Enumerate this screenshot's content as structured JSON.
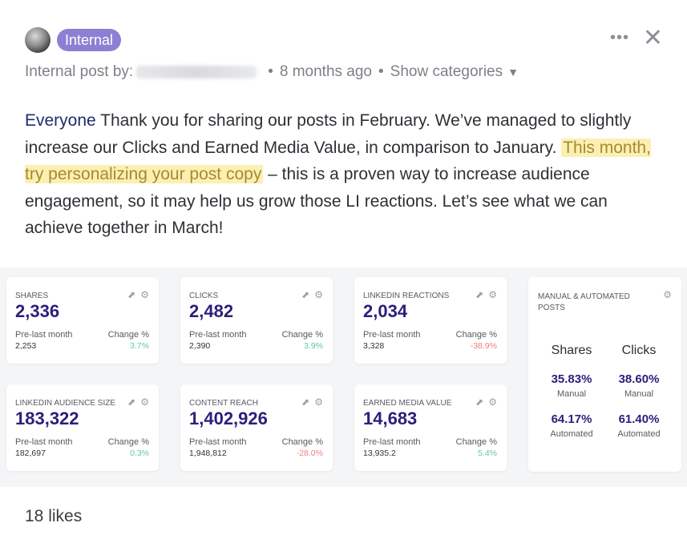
{
  "header": {
    "tag": "Internal",
    "menu_icon": "more-dots-icon",
    "close_icon": "close-icon"
  },
  "meta": {
    "prefix": "Internal post by:",
    "time": "8 months ago",
    "categories_toggle": "Show categories"
  },
  "post": {
    "mention": "Everyone",
    "text_before": " Thank you for sharing our posts in February. We’ve managed to slightly increase our Clicks and Earned Media Value, in comparison to January. ",
    "highlight": "This month, try personalizing your post copy",
    "text_after": " – this is a proven way to increase audience engagement, so it may help us grow those LI reactions. Let’s see what we can achieve together in March!"
  },
  "cards": [
    {
      "title": "SHARES",
      "value": "2,336",
      "prev_label": "Pre-last month",
      "prev": "2,253",
      "change_label": "Change %",
      "change": "3.7%",
      "trend": "pos"
    },
    {
      "title": "CLICKS",
      "value": "2,482",
      "prev_label": "Pre-last month",
      "prev": "2,390",
      "change_label": "Change %",
      "change": "3.9%",
      "trend": "pos"
    },
    {
      "title": "LINKEDIN REACTIONS",
      "value": "2,034",
      "prev_label": "Pre-last month",
      "prev": "3,328",
      "change_label": "Change %",
      "change": "-38.9%",
      "trend": "neg"
    },
    {
      "title": "LINKEDIN AUDIENCE SIZE",
      "value": "183,322",
      "prev_label": "Pre-last month",
      "prev": "182,697",
      "change_label": "Change %",
      "change": "0.3%",
      "trend": "pos"
    },
    {
      "title": "CONTENT REACH",
      "value": "1,402,926",
      "prev_label": "Pre-last month",
      "prev": "1,948,812",
      "change_label": "Change %",
      "change": "-28.0%",
      "trend": "neg"
    },
    {
      "title": "EARNED MEDIA VALUE",
      "value": "14,683",
      "prev_label": "Pre-last month",
      "prev": "13,935.2",
      "change_label": "Change %",
      "change": "5.4%",
      "trend": "pos"
    }
  ],
  "manual_card": {
    "title": "MANUAL & AUTOMATED POSTS",
    "columns": [
      {
        "heading": "Shares",
        "manual_pct": "35.83%",
        "manual_label": "Manual",
        "auto_pct": "64.17%",
        "auto_label": "Automated"
      },
      {
        "heading": "Clicks",
        "manual_pct": "38.60%",
        "manual_label": "Manual",
        "auto_pct": "61.40%",
        "auto_label": "Automated"
      }
    ]
  },
  "footer": {
    "likes": "18 likes"
  },
  "colors": {
    "tag": "#8d7fd3",
    "value": "#2e1d7a",
    "positive": "#5fc9a9",
    "negative": "#f07d7d",
    "highlight_bg": "#fbefb3"
  }
}
